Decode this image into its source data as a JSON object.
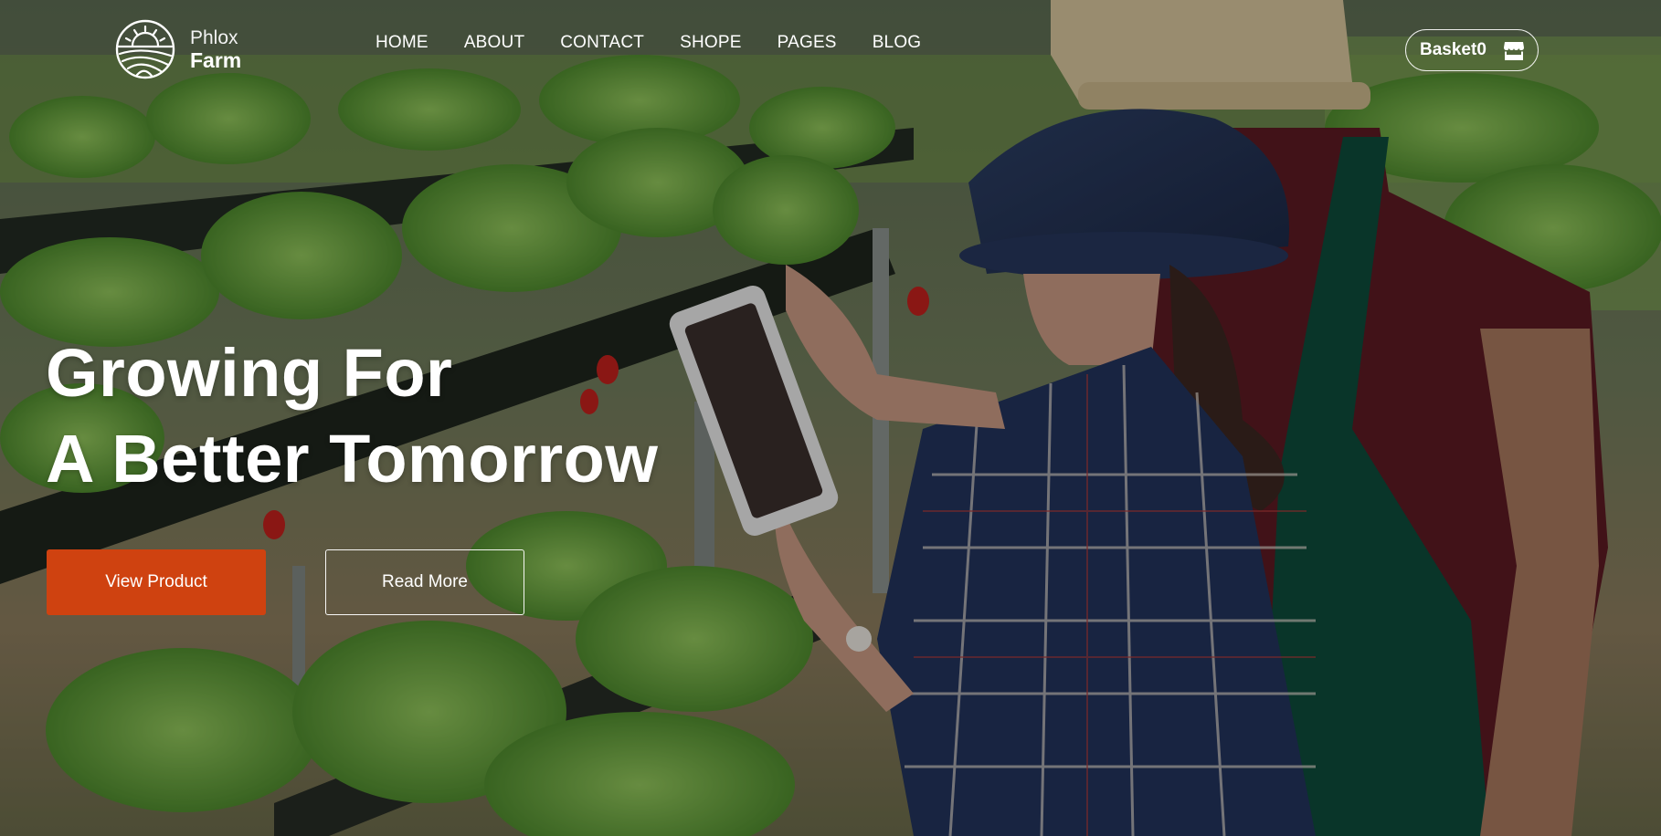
{
  "brand": {
    "name_line1": "Phlox",
    "name_line2": "Farm",
    "logo_icon": "sun-over-field-icon"
  },
  "nav": {
    "items": [
      {
        "label": "HOME"
      },
      {
        "label": "ABOUT"
      },
      {
        "label": "CONTACT"
      },
      {
        "label": "SHOPE"
      },
      {
        "label": "PAGES"
      },
      {
        "label": "BLOG"
      }
    ]
  },
  "basket": {
    "label": "Basket",
    "count": "0",
    "icon": "store-icon"
  },
  "hero": {
    "headline_line1": "Growing For",
    "headline_line2": "A Better Tomorrow",
    "primary_button": "View Product",
    "secondary_button": "Read More"
  },
  "colors": {
    "accent": "#cf4210",
    "text": "#ffffff"
  }
}
